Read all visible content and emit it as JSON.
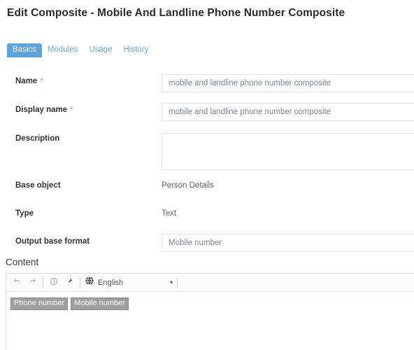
{
  "header": {
    "title": "Edit Composite - Mobile And Landline Phone Number Composite"
  },
  "tabs": [
    {
      "label": "Basics",
      "active": true
    },
    {
      "label": "Modules",
      "active": false
    },
    {
      "label": "Usage",
      "active": false
    },
    {
      "label": "History",
      "active": false
    }
  ],
  "form": {
    "name": {
      "label": "Name",
      "required_marker": "*",
      "value": "mobile and landline phone number composite",
      "placeholder": ""
    },
    "display_name": {
      "label": "Display name",
      "required_marker": "*",
      "value": "mobile and landline phone number composite",
      "placeholder": ""
    },
    "description": {
      "label": "Description",
      "value": "",
      "placeholder": ""
    },
    "base_object": {
      "label": "Base object",
      "value": "Person Details"
    },
    "type": {
      "label": "Type",
      "value": "Text"
    },
    "output_base_format": {
      "label": "Output base format",
      "value": "Mobile number",
      "placeholder": ""
    }
  },
  "content": {
    "section_title": "Content",
    "toolbar": {
      "undo_icon": "undo-icon",
      "redo_icon": "redo-icon",
      "history_icon": "clock-icon",
      "pin_icon": "pin-icon",
      "language_icon": "globe-icon",
      "language_label": "English",
      "caret_glyph": "▾"
    },
    "tokens": [
      {
        "label": "Phone number"
      },
      {
        "label": "Mobile number"
      }
    ]
  },
  "colors": {
    "accent": "#5fa3dd",
    "tab_text": "#6ea9d6",
    "required": "#d9725a",
    "field_border": "#dfe3e9",
    "field_text": "#7a8699",
    "chip_bg": "#9f9f9f"
  }
}
